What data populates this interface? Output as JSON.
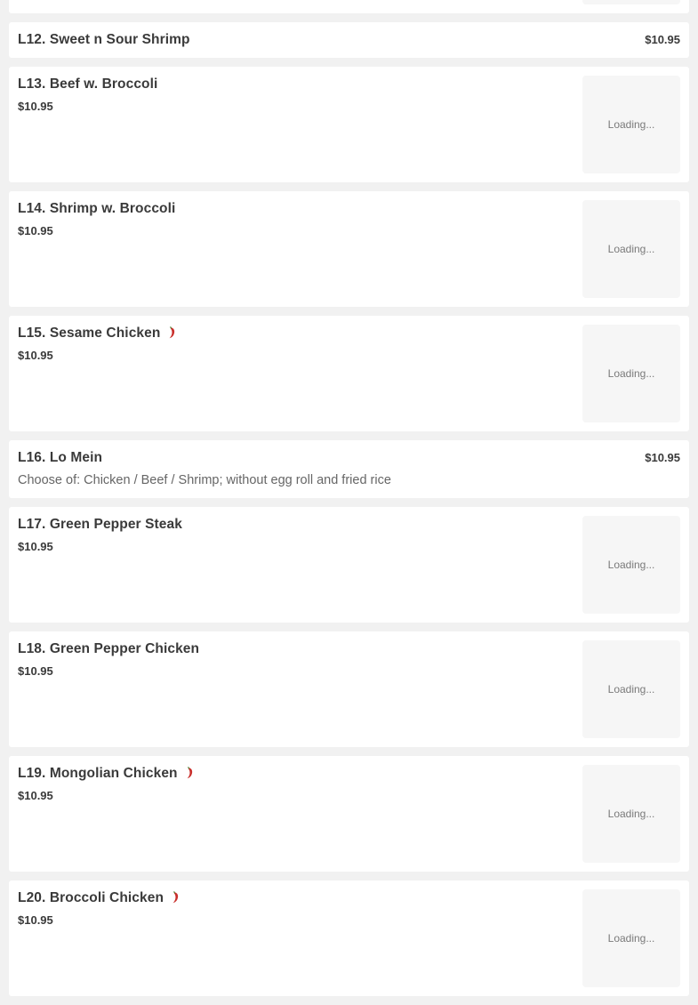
{
  "loading_text": "Loading...",
  "items": [
    {
      "name": "",
      "price": "",
      "image_text": "Loading..."
    },
    {
      "name": "L12. Sweet n Sour Shrimp",
      "price": "$10.95"
    },
    {
      "name": "L13. Beef w. Broccoli",
      "price": "$10.95",
      "image_text": "Loading..."
    },
    {
      "name": "L14. Shrimp w. Broccoli",
      "price": "$10.95",
      "image_text": "Loading..."
    },
    {
      "name": "L15. Sesame Chicken",
      "price": "$10.95",
      "image_text": "Loading...",
      "icon": "chili-pepper-icon"
    },
    {
      "name": "L16. Lo Mein",
      "price": "$10.95",
      "description": "Choose of: Chicken / Beef / Shrimp; without egg roll and fried rice"
    },
    {
      "name": "L17. Green Pepper Steak",
      "price": "$10.95",
      "image_text": "Loading..."
    },
    {
      "name": "L18. Green Pepper Chicken",
      "price": "$10.95",
      "image_text": "Loading..."
    },
    {
      "name": "L19. Mongolian Chicken",
      "price": "$10.95",
      "image_text": "Loading...",
      "icon": "chili-pepper-icon"
    },
    {
      "name": "L20. Broccoli Chicken",
      "price": "$10.95",
      "image_text": "Loading...",
      "icon": "chili-pepper-icon"
    }
  ],
  "colors": {
    "background": "#f1f1f1",
    "card": "#ffffff",
    "spicy": "#c9302c"
  }
}
